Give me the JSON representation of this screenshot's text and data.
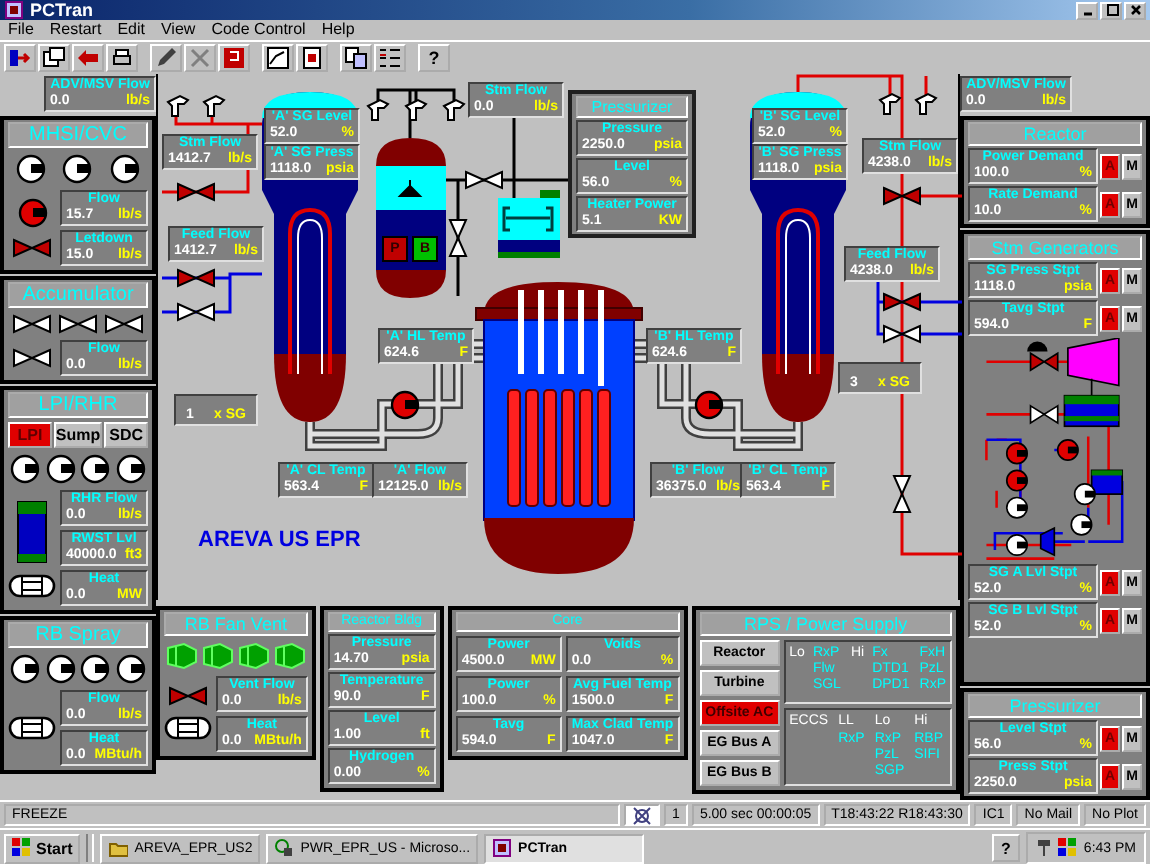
{
  "window": {
    "title": "PCTran"
  },
  "menu": [
    "File",
    "Restart",
    "Edit",
    "View",
    "Code Control",
    "Help"
  ],
  "toolbar_help": "?",
  "left": {
    "adv_msv_flow": {
      "label": "ADV/MSV Flow",
      "value": "0.0",
      "unit": "lb/s"
    },
    "mhsi_cvc": {
      "title": "MHSI/CVC",
      "pumps": [
        {
          "running": false
        },
        {
          "running": false
        },
        {
          "running": false
        },
        {
          "running": true
        }
      ],
      "valve": {
        "open": true
      },
      "readouts": [
        {
          "label": "Flow",
          "value": "15.7",
          "unit": "lb/s"
        },
        {
          "label": "Letdown",
          "value": "15.0",
          "unit": "lb/s"
        }
      ]
    },
    "accumulator": {
      "title": "Accumulator",
      "valves": [
        {
          "open": false
        },
        {
          "open": false
        },
        {
          "open": false
        },
        {
          "open": false
        }
      ],
      "readouts": [
        {
          "label": "Flow",
          "value": "0.0",
          "unit": "lb/s"
        }
      ]
    },
    "lpi_rhr": {
      "title": "LPI/RHR",
      "modes": [
        {
          "label": "LPI",
          "selected": true
        },
        {
          "label": "Sump",
          "selected": false
        },
        {
          "label": "SDC",
          "selected": false
        }
      ],
      "pumps": [
        {
          "running": false
        },
        {
          "running": false
        },
        {
          "running": false
        },
        {
          "running": false
        }
      ],
      "readouts": [
        {
          "label": "RHR Flow",
          "value": "0.0",
          "unit": "lb/s"
        },
        {
          "label": "RWST Lvl",
          "value": "40000.0",
          "unit": "ft3"
        },
        {
          "label": "Heat",
          "value": "0.0",
          "unit": "MW"
        }
      ]
    },
    "rb_spray": {
      "title": "RB Spray",
      "pumps": [
        {
          "running": false
        },
        {
          "running": false
        },
        {
          "running": false
        },
        {
          "running": false
        }
      ],
      "readouts": [
        {
          "label": "Flow",
          "value": "0.0",
          "unit": "lb/s"
        },
        {
          "label": "Heat",
          "value": "0.0",
          "unit": "MBtu/h"
        }
      ]
    }
  },
  "diagram": {
    "readouts": [
      {
        "label": "Stm Flow",
        "value": "1412.7",
        "unit": "lb/s"
      },
      {
        "label": "Feed Flow",
        "value": "1412.7",
        "unit": "lb/s"
      },
      {
        "label": "'A' SG Level",
        "value": "52.0",
        "unit": "%"
      },
      {
        "label": "'A' SG Press",
        "value": "1118.0",
        "unit": "psia"
      },
      {
        "label": "Stm Flow",
        "value": "0.0",
        "unit": "lb/s"
      },
      {
        "label": "'B' SG Level",
        "value": "52.0",
        "unit": "%"
      },
      {
        "label": "'B' SG Press",
        "value": "1118.0",
        "unit": "psia"
      },
      {
        "label": "Stm Flow",
        "value": "4238.0",
        "unit": "lb/s"
      },
      {
        "label": "Feed Flow",
        "value": "4238.0",
        "unit": "lb/s"
      },
      {
        "label": "'A' HL Temp",
        "value": "624.6",
        "unit": "F"
      },
      {
        "label": "'B' HL Temp",
        "value": "624.6",
        "unit": "F"
      },
      {
        "label": "'A' CL Temp",
        "value": "563.4",
        "unit": "F"
      },
      {
        "label": "'A' Flow",
        "value": "12125.0",
        "unit": "lb/s"
      },
      {
        "label": "'B' Flow",
        "value": "36375.0",
        "unit": "lb/s"
      },
      {
        "label": "'B' CL Temp",
        "value": "563.4",
        "unit": "F"
      }
    ],
    "loop_counts": [
      {
        "value": "1",
        "unit": "x SG"
      },
      {
        "value": "3",
        "unit": "x SG"
      }
    ],
    "valves": [
      {
        "open": true
      },
      {
        "open": true
      },
      {
        "open": false
      },
      {
        "open": false
      },
      {
        "open": false
      },
      {
        "open": true
      },
      {
        "open": true
      },
      {
        "open": false
      },
      {
        "open": false
      }
    ],
    "coolant_pumps": [
      {
        "running": true
      },
      {
        "running": true
      }
    ],
    "heater_buttons": [
      {
        "label": "P",
        "color": "#c00000"
      },
      {
        "label": "B",
        "color": "#00c000"
      }
    ],
    "pressurizer": {
      "title": "Pressurizer",
      "readouts": [
        {
          "label": "Pressure",
          "value": "2250.0",
          "unit": "psia"
        },
        {
          "label": "Level",
          "value": "56.0",
          "unit": "%"
        },
        {
          "label": "Heater Power",
          "value": "5.1",
          "unit": "KW"
        }
      ]
    },
    "plant_label": "AREVA US EPR"
  },
  "bottom": {
    "rb_fan_vent": {
      "title": "RB Fan Vent",
      "fans": [
        {
          "running": true
        },
        {
          "running": true
        },
        {
          "running": true
        },
        {
          "running": true
        }
      ],
      "valve": {
        "open": true
      },
      "readouts": [
        {
          "label": "Vent Flow",
          "value": "0.0",
          "unit": "lb/s"
        },
        {
          "label": "Heat",
          "value": "0.0",
          "unit": "MBtu/h"
        }
      ]
    },
    "reactor_bldg": {
      "title": "Reactor Bldg",
      "readouts": [
        {
          "label": "Pressure",
          "value": "14.70",
          "unit": "psia"
        },
        {
          "label": "Temperature",
          "value": "90.0",
          "unit": "F"
        },
        {
          "label": "Level",
          "value": "1.00",
          "unit": "ft"
        },
        {
          "label": "Hydrogen",
          "value": "0.00",
          "unit": "%"
        }
      ]
    },
    "core": {
      "title": "Core",
      "readouts": [
        {
          "label": "Power",
          "value": "4500.0",
          "unit": "MW"
        },
        {
          "label": "Voids",
          "value": "0.0",
          "unit": "%"
        },
        {
          "label": "Power",
          "value": "100.0",
          "unit": "%"
        },
        {
          "label": "Avg Fuel Temp",
          "value": "1500.0",
          "unit": "F"
        },
        {
          "label": "Tavg",
          "value": "594.0",
          "unit": "F"
        },
        {
          "label": "Max Clad Temp",
          "value": "1047.0",
          "unit": "F"
        }
      ]
    },
    "rps": {
      "title": "RPS / Power Supply",
      "buttons": [
        {
          "label": "Reactor",
          "tripped": false
        },
        {
          "label": "Turbine",
          "tripped": false
        },
        {
          "label": "Offsite AC",
          "tripped": true
        },
        {
          "label": "EG Bus A",
          "tripped": false
        },
        {
          "label": "EG Bus B",
          "tripped": false
        }
      ],
      "trip_groups": [
        {
          "kind": "inline",
          "items": [
            {
              "label": "Lo",
              "columns": [
                [
                  "RxP",
                  "Flw",
                  "SGL"
                ]
              ]
            },
            {
              "label": "Hi",
              "columns": [
                [
                  "Fx",
                  "DTD1",
                  "DPD1"
                ],
                [
                  "FxH",
                  "PzL",
                  "RxP"
                ]
              ]
            }
          ]
        },
        {
          "kind": "stacked",
          "title": "ECCS",
          "items": [
            {
              "label": "LL",
              "columns": [
                [
                  "RxP"
                ]
              ]
            },
            {
              "label": "Lo",
              "columns": [
                [
                  "RxP",
                  "PzL",
                  "SGP"
                ]
              ]
            },
            {
              "label": "Hi",
              "columns": [
                [
                  "RBP",
                  "SIFI"
                ]
              ]
            }
          ]
        }
      ]
    }
  },
  "right": {
    "adv_msv_flow": {
      "label": "ADV/MSV Flow",
      "value": "0.0",
      "unit": "lb/s"
    },
    "reactor": {
      "title": "Reactor",
      "rows": [
        {
          "readout": {
            "label": "Power Demand",
            "value": "100.0",
            "unit": "%"
          },
          "modes": [
            {
              "label": "A",
              "selected": true
            },
            {
              "label": "M",
              "selected": false
            }
          ]
        },
        {
          "readout": {
            "label": "Rate Demand",
            "value": "10.0",
            "unit": "%"
          },
          "modes": [
            {
              "label": "A",
              "selected": true
            },
            {
              "label": "M",
              "selected": false
            }
          ]
        }
      ]
    },
    "stm_generators": {
      "title": "Stm Generators",
      "rows": [
        {
          "readout": {
            "label": "SG Press Stpt",
            "value": "1118.0",
            "unit": "psia"
          },
          "modes": [
            {
              "label": "A",
              "selected": true
            },
            {
              "label": "M",
              "selected": false
            }
          ]
        },
        {
          "readout": {
            "label": "Tavg Stpt",
            "value": "594.0",
            "unit": "F"
          },
          "modes": [
            {
              "label": "A",
              "selected": true
            },
            {
              "label": "M",
              "selected": false
            }
          ]
        }
      ],
      "lower_rows": [
        {
          "readout": {
            "label": "SG A Lvl Stpt",
            "value": "52.0",
            "unit": "%"
          },
          "modes": [
            {
              "label": "A",
              "selected": true
            },
            {
              "label": "M",
              "selected": false
            }
          ]
        },
        {
          "readout": {
            "label": "SG B Lvl Stpt",
            "value": "52.0",
            "unit": "%"
          },
          "modes": [
            {
              "label": "A",
              "selected": true
            },
            {
              "label": "M",
              "selected": false
            }
          ]
        }
      ]
    },
    "pressurizer": {
      "title": "Pressurizer",
      "rows": [
        {
          "readout": {
            "label": "Level Stpt",
            "value": "56.0",
            "unit": "%"
          },
          "modes": [
            {
              "label": "A",
              "selected": true
            },
            {
              "label": "M",
              "selected": false
            }
          ]
        },
        {
          "readout": {
            "label": "Press Stpt",
            "value": "2250.0",
            "unit": "psia"
          },
          "modes": [
            {
              "label": "A",
              "selected": true
            },
            {
              "label": "M",
              "selected": false
            }
          ]
        }
      ]
    }
  },
  "status_bar": {
    "mode": "FREEZE",
    "cells": [
      "1",
      "5.00 sec  00:00:05",
      "T18:43:22 R18:43:30",
      "IC1",
      "No Mail",
      "No Plot"
    ]
  },
  "taskbar": {
    "start": "Start",
    "tasks": [
      {
        "label": "AREVA_EPR_US2",
        "kind": "folder",
        "selected": false
      },
      {
        "label": "PWR_EPR_US - Microso...",
        "kind": "app",
        "selected": false
      },
      {
        "label": "PCTran",
        "kind": "pctran",
        "selected": true
      }
    ],
    "tray_help": "?",
    "clock": "6:43 PM"
  }
}
